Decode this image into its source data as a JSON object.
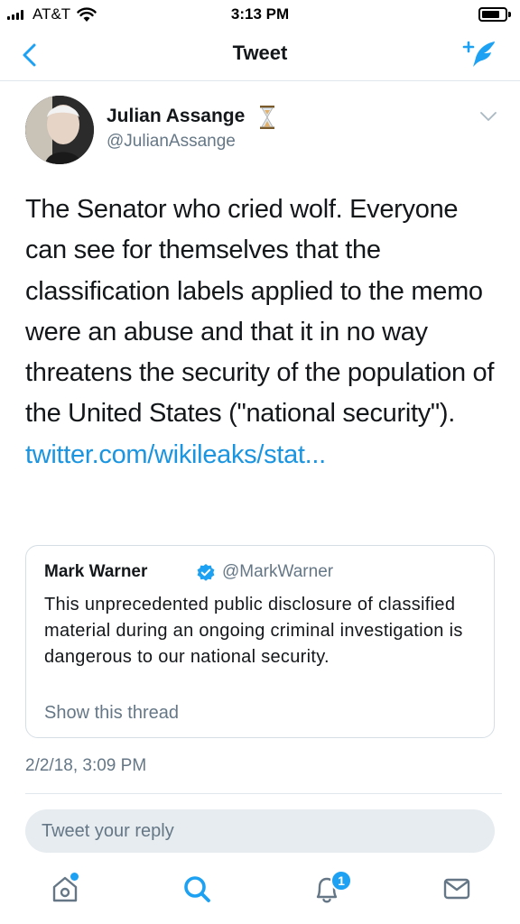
{
  "status_bar": {
    "carrier": "AT&T",
    "time": "3:13 PM"
  },
  "nav": {
    "title": "Tweet",
    "back_icon": "chevron-left-icon",
    "compose_icon": "compose-tweet-icon"
  },
  "tweet": {
    "author_name": "Julian Assange",
    "author_handle": "@JulianAssange",
    "text": "The Senator who cried wolf. Everyone can see for themselves that the classification labels applied to the memo were an abuse and that it in no way threatens the security of the population of the United States (\"national security\"). ",
    "link": "twitter.com/wikileaks/stat...",
    "timestamp": "2/2/18, 3:09 PM"
  },
  "quoted_tweet": {
    "author_name": "Mark Warner",
    "author_handle": "@MarkWarner",
    "text": "This unprecedented public disclosure of classified material during an ongoing criminal investigation is dangerous to our national security.",
    "show_thread": "Show this thread"
  },
  "reply": {
    "placeholder": "Tweet your reply"
  },
  "tab_bar": {
    "tabs": [
      "home-icon",
      "search-icon",
      "notifications-icon",
      "messages-icon"
    ],
    "notification_count": "1"
  },
  "colors": {
    "accent": "#1da1f2",
    "link": "#1b95e0",
    "text": "#14171a",
    "secondary": "#657786"
  }
}
